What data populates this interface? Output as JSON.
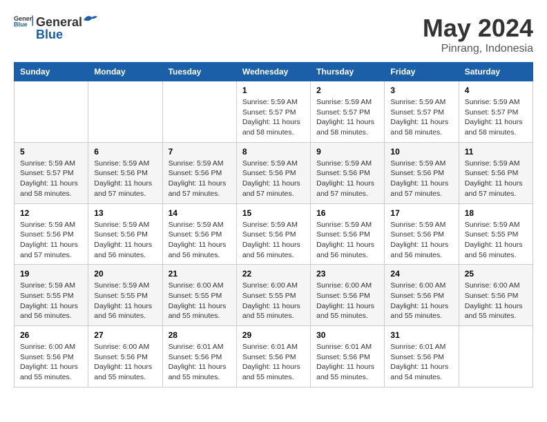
{
  "header": {
    "logo_general": "General",
    "logo_blue": "Blue",
    "month_year": "May 2024",
    "location": "Pinrang, Indonesia"
  },
  "weekdays": [
    "Sunday",
    "Monday",
    "Tuesday",
    "Wednesday",
    "Thursday",
    "Friday",
    "Saturday"
  ],
  "weeks": [
    [
      {
        "day": "",
        "info": ""
      },
      {
        "day": "",
        "info": ""
      },
      {
        "day": "",
        "info": ""
      },
      {
        "day": "1",
        "info": "Sunrise: 5:59 AM\nSunset: 5:57 PM\nDaylight: 11 hours\nand 58 minutes."
      },
      {
        "day": "2",
        "info": "Sunrise: 5:59 AM\nSunset: 5:57 PM\nDaylight: 11 hours\nand 58 minutes."
      },
      {
        "day": "3",
        "info": "Sunrise: 5:59 AM\nSunset: 5:57 PM\nDaylight: 11 hours\nand 58 minutes."
      },
      {
        "day": "4",
        "info": "Sunrise: 5:59 AM\nSunset: 5:57 PM\nDaylight: 11 hours\nand 58 minutes."
      }
    ],
    [
      {
        "day": "5",
        "info": "Sunrise: 5:59 AM\nSunset: 5:57 PM\nDaylight: 11 hours\nand 58 minutes."
      },
      {
        "day": "6",
        "info": "Sunrise: 5:59 AM\nSunset: 5:56 PM\nDaylight: 11 hours\nand 57 minutes."
      },
      {
        "day": "7",
        "info": "Sunrise: 5:59 AM\nSunset: 5:56 PM\nDaylight: 11 hours\nand 57 minutes."
      },
      {
        "day": "8",
        "info": "Sunrise: 5:59 AM\nSunset: 5:56 PM\nDaylight: 11 hours\nand 57 minutes."
      },
      {
        "day": "9",
        "info": "Sunrise: 5:59 AM\nSunset: 5:56 PM\nDaylight: 11 hours\nand 57 minutes."
      },
      {
        "day": "10",
        "info": "Sunrise: 5:59 AM\nSunset: 5:56 PM\nDaylight: 11 hours\nand 57 minutes."
      },
      {
        "day": "11",
        "info": "Sunrise: 5:59 AM\nSunset: 5:56 PM\nDaylight: 11 hours\nand 57 minutes."
      }
    ],
    [
      {
        "day": "12",
        "info": "Sunrise: 5:59 AM\nSunset: 5:56 PM\nDaylight: 11 hours\nand 57 minutes."
      },
      {
        "day": "13",
        "info": "Sunrise: 5:59 AM\nSunset: 5:56 PM\nDaylight: 11 hours\nand 56 minutes."
      },
      {
        "day": "14",
        "info": "Sunrise: 5:59 AM\nSunset: 5:56 PM\nDaylight: 11 hours\nand 56 minutes."
      },
      {
        "day": "15",
        "info": "Sunrise: 5:59 AM\nSunset: 5:56 PM\nDaylight: 11 hours\nand 56 minutes."
      },
      {
        "day": "16",
        "info": "Sunrise: 5:59 AM\nSunset: 5:56 PM\nDaylight: 11 hours\nand 56 minutes."
      },
      {
        "day": "17",
        "info": "Sunrise: 5:59 AM\nSunset: 5:56 PM\nDaylight: 11 hours\nand 56 minutes."
      },
      {
        "day": "18",
        "info": "Sunrise: 5:59 AM\nSunset: 5:55 PM\nDaylight: 11 hours\nand 56 minutes."
      }
    ],
    [
      {
        "day": "19",
        "info": "Sunrise: 5:59 AM\nSunset: 5:55 PM\nDaylight: 11 hours\nand 56 minutes."
      },
      {
        "day": "20",
        "info": "Sunrise: 5:59 AM\nSunset: 5:55 PM\nDaylight: 11 hours\nand 56 minutes."
      },
      {
        "day": "21",
        "info": "Sunrise: 6:00 AM\nSunset: 5:55 PM\nDaylight: 11 hours\nand 55 minutes."
      },
      {
        "day": "22",
        "info": "Sunrise: 6:00 AM\nSunset: 5:55 PM\nDaylight: 11 hours\nand 55 minutes."
      },
      {
        "day": "23",
        "info": "Sunrise: 6:00 AM\nSunset: 5:56 PM\nDaylight: 11 hours\nand 55 minutes."
      },
      {
        "day": "24",
        "info": "Sunrise: 6:00 AM\nSunset: 5:56 PM\nDaylight: 11 hours\nand 55 minutes."
      },
      {
        "day": "25",
        "info": "Sunrise: 6:00 AM\nSunset: 5:56 PM\nDaylight: 11 hours\nand 55 minutes."
      }
    ],
    [
      {
        "day": "26",
        "info": "Sunrise: 6:00 AM\nSunset: 5:56 PM\nDaylight: 11 hours\nand 55 minutes."
      },
      {
        "day": "27",
        "info": "Sunrise: 6:00 AM\nSunset: 5:56 PM\nDaylight: 11 hours\nand 55 minutes."
      },
      {
        "day": "28",
        "info": "Sunrise: 6:01 AM\nSunset: 5:56 PM\nDaylight: 11 hours\nand 55 minutes."
      },
      {
        "day": "29",
        "info": "Sunrise: 6:01 AM\nSunset: 5:56 PM\nDaylight: 11 hours\nand 55 minutes."
      },
      {
        "day": "30",
        "info": "Sunrise: 6:01 AM\nSunset: 5:56 PM\nDaylight: 11 hours\nand 55 minutes."
      },
      {
        "day": "31",
        "info": "Sunrise: 6:01 AM\nSunset: 5:56 PM\nDaylight: 11 hours\nand 54 minutes."
      },
      {
        "day": "",
        "info": ""
      }
    ]
  ]
}
